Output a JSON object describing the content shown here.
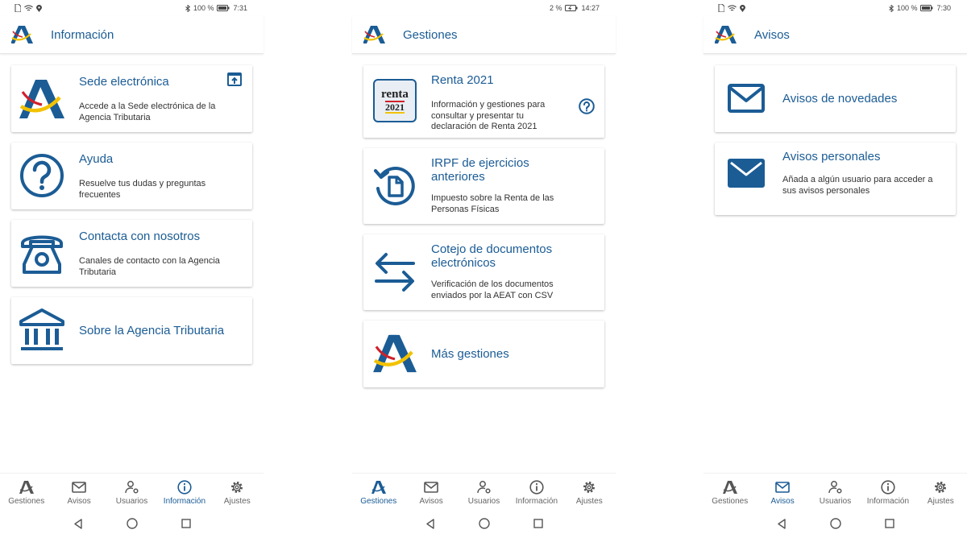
{
  "screens": [
    {
      "status": {
        "battery": "100 %",
        "time": "7:31"
      },
      "title": "Información",
      "cards": [
        {
          "title": "Sede electrónica",
          "desc": "Accede a la Sede electrónica de la Agencia Tributaria",
          "icon": "aeat-logo-icon"
        },
        {
          "title": "Ayuda",
          "desc": "Resuelve tus dudas y preguntas frecuentes",
          "icon": "help-circle-icon"
        },
        {
          "title": "Contacta con nosotros",
          "desc": "Canales de contacto con la Agencia Tributaria",
          "icon": "telephone-icon"
        },
        {
          "title": "Sobre la Agencia Tributaria",
          "desc": "",
          "icon": "institution-icon"
        }
      ]
    },
    {
      "status": {
        "battery": "2 %",
        "time": "14:27"
      },
      "title": "Gestiones",
      "cards": [
        {
          "title": "Renta 2021",
          "desc": "Información y gestiones para consultar y presentar tu declaración de Renta 2021",
          "icon": "renta-2021-icon",
          "badge_word": "renta",
          "badge_year": "2021"
        },
        {
          "title": "IRPF de ejercicios anteriores",
          "desc": "Impuesto sobre la Renta de las Personas Físicas",
          "icon": "document-history-icon"
        },
        {
          "title": "Cotejo de documentos electrónicos",
          "desc": "Verificación de los documentos enviados por la AEAT con CSV",
          "icon": "swap-arrows-icon"
        },
        {
          "title": "Más gestiones",
          "desc": "",
          "icon": "aeat-logo-icon"
        }
      ]
    },
    {
      "status": {
        "battery": "100 %",
        "time": "7:30"
      },
      "title": "Avisos",
      "cards": [
        {
          "title": "Avisos de novedades",
          "desc": "",
          "icon": "envelope-outline-icon"
        },
        {
          "title": "Avisos personales",
          "desc": "Añada a algún usuario para acceder a sus avisos personales",
          "icon": "envelope-filled-icon"
        }
      ]
    }
  ],
  "nav": {
    "items": [
      {
        "label": "Gestiones",
        "icon": "aeat-logo-icon"
      },
      {
        "label": "Avisos",
        "icon": "envelope-icon"
      },
      {
        "label": "Usuarios",
        "icon": "user-settings-icon"
      },
      {
        "label": "Información",
        "icon": "info-icon"
      },
      {
        "label": "Ajustes",
        "icon": "gear-icon"
      }
    ],
    "active_per_screen": [
      "Información",
      "Gestiones",
      "Avisos"
    ]
  },
  "colors": {
    "primary": "#1b5c95",
    "accent_yellow": "#f2c200",
    "accent_red": "#d0212a"
  }
}
